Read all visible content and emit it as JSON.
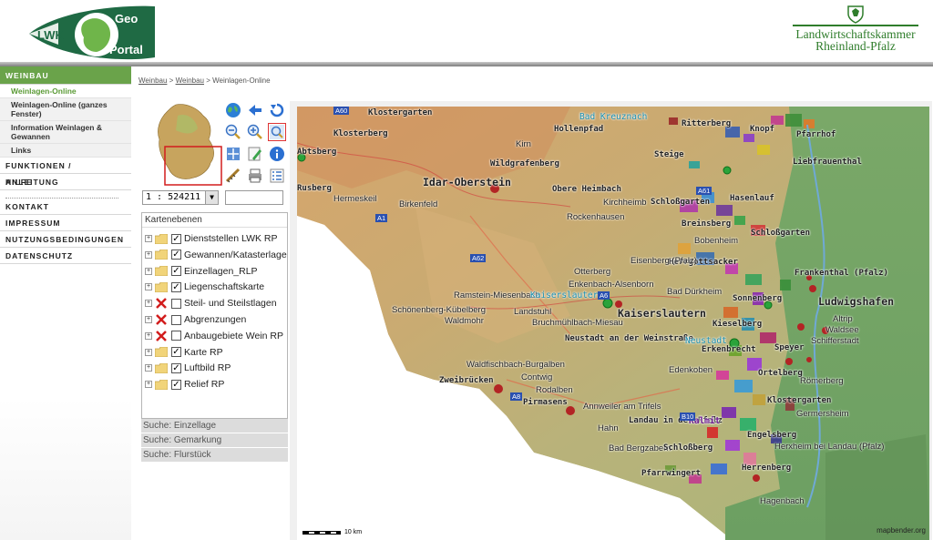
{
  "header": {
    "geo_logo_text": {
      "lwk": "LWK",
      "geo": "Geo",
      "portal": "Portal"
    },
    "chamber_line1": "Landwirtschaftskammer",
    "chamber_line2": "Rheinland-Pfalz"
  },
  "sidebar": {
    "weinbau": "WEINBAU",
    "sub_items": [
      {
        "label": "Weinlagen-Online"
      },
      {
        "label": "Weinlagen-Online (ganzes Fenster)"
      },
      {
        "label": "Information Weinlagen & Gewannen"
      },
      {
        "label": "Links"
      }
    ],
    "funktionen": "FUNKTIONEN / ANLEITUNG",
    "hilfe": "HILFE",
    "kontakt": "KONTAKT",
    "impressum": "IMPRESSUM",
    "nutzung": "NUTZUNGSBEDINGUNGEN",
    "datenschutz": "DATENSCHUTZ"
  },
  "breadcrumb": {
    "item1": "Weinbau",
    "sep1": " > ",
    "item2": "Weinbau",
    "sep2": " > ",
    "item3": "Weinlagen-Online"
  },
  "toolbar": {
    "icons": [
      "globe-icon",
      "back-arrow-icon",
      "refresh-icon",
      "zoom-out-icon",
      "zoom-in-icon",
      "zoom-box-icon",
      "pan-icon",
      "edit-icon",
      "info-icon",
      "measure-icon",
      "print-icon",
      "legend-icon"
    ]
  },
  "scale": {
    "value": "1 : 524211",
    "input_value": ""
  },
  "layers": {
    "title": "Kartenebenen",
    "items": [
      {
        "label": "Dienststellen LWK RP",
        "checked": true,
        "icon": "folder"
      },
      {
        "label": "Gewannen/Katasterlage",
        "checked": true,
        "icon": "folder"
      },
      {
        "label": "Einzellagen_RLP",
        "checked": true,
        "icon": "folder"
      },
      {
        "label": "Liegenschaftskarte",
        "checked": true,
        "icon": "folder"
      },
      {
        "label": "Steil- und Steilstlagen",
        "checked": false,
        "icon": "red-x"
      },
      {
        "label": "Abgrenzungen",
        "checked": false,
        "icon": "red-x"
      },
      {
        "label": "Anbaugebiete Wein RP",
        "checked": false,
        "icon": "red-x"
      },
      {
        "label": "Karte RP",
        "checked": true,
        "icon": "folder"
      },
      {
        "label": "Luftbild RP",
        "checked": true,
        "icon": "folder"
      },
      {
        "label": "Relief RP",
        "checked": true,
        "icon": "folder"
      }
    ]
  },
  "search": {
    "einzellage": "Suche: Einzellage",
    "gemarkung": "Suche: Gemarkung",
    "flurstueck": "Suche: Flurstück"
  },
  "map": {
    "places": [
      "Klostergarten",
      "Klosterberg",
      "Bad Kreuznach",
      "Hollenpfad",
      "Ritterberg",
      "Knopf",
      "Pfarrhof",
      "Abtsberg",
      "Kirn",
      "Wildgrafenberg",
      "Steige",
      "Liebfrauenthal",
      "Idar-Oberstein",
      "Obere Heimbach",
      "Rusberg",
      "Hermeskeil",
      "Birkenfeld",
      "Kirchheimb",
      "Schloßgarten",
      "Hasenlauf",
      "Rockenhausen",
      "Breinsberg",
      "Schloßgarten",
      "Bobenheim",
      "Herrgottsacker",
      "Otterberg",
      "Eisenberg (Pfalz)",
      "Frankenthal (Pfalz)",
      "Ramstein-Miesenbach",
      "Kaiserslautern",
      "Enkenbach-Alsenborn",
      "Bad Dürkheim",
      "Sonnenberg",
      "Ludwigshafen",
      "Schönenberg-Kübelberg",
      "Landstuhl",
      "Kaiserslautern",
      "Kieselberg",
      "Altrip",
      "Waldmohr",
      "Bruchmühlbach-Miesau",
      "Waldsee",
      "Neustadt an der Weinstraße",
      "Neustadt",
      "Schifferstadt",
      "Erkenbrecht",
      "Speyer",
      "Waldfischbach-Burgalben",
      "Edenkoben",
      "Ortelberg",
      "Zweibrücken",
      "Contwig",
      "Römerberg",
      "Rodalben",
      "Klostergarten",
      "Pirmasens",
      "Annweiler am Trifels",
      "Germersheim",
      "Landau in der Pfalz",
      "Kalmit",
      "Hahn",
      "Engelsberg",
      "Bad Bergzabern",
      "Schloßberg",
      "Herxheim bei Landau (Pfalz)",
      "Herrenberg",
      "Pfarrwingert",
      "Hagenbach"
    ],
    "roads": [
      "A60",
      "A1",
      "A62",
      "A6",
      "A8",
      "A61",
      "B10"
    ],
    "scale_label": "10 km",
    "credit": "mapbender.org"
  }
}
